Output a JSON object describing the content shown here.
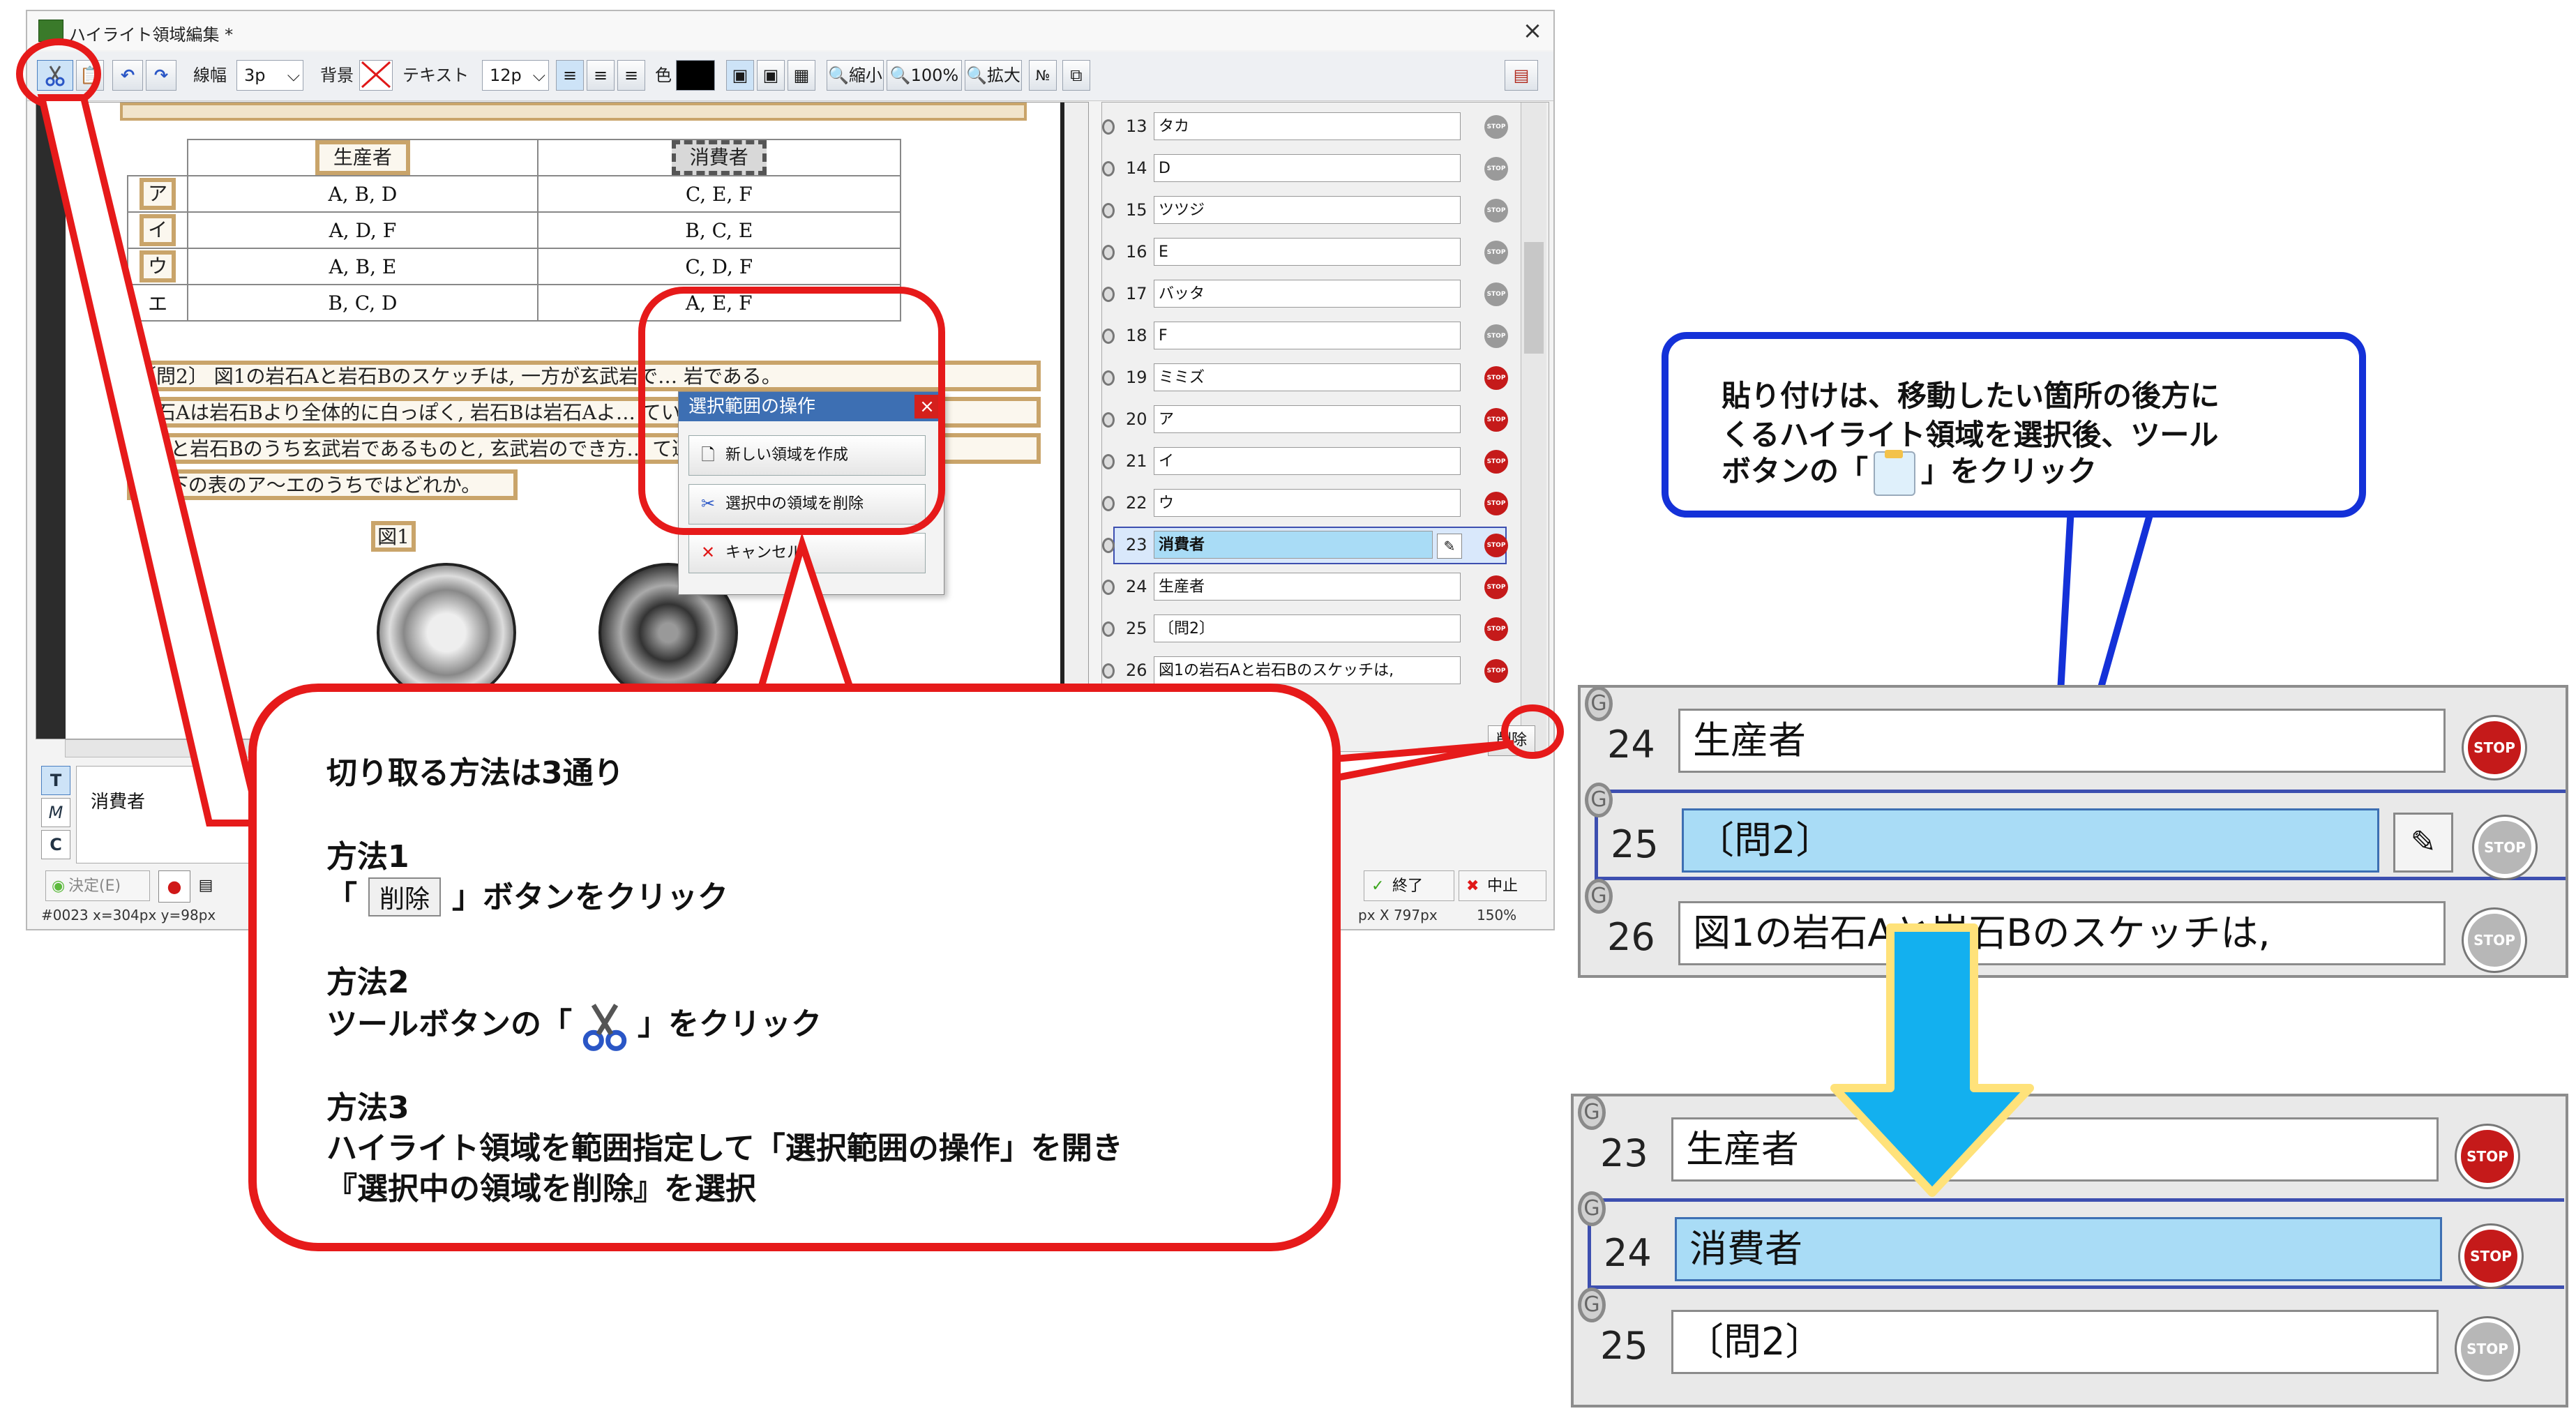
{
  "window": {
    "title": "ハイライト領域編集 *",
    "close_glyph": "×"
  },
  "toolbar": {
    "line_width_label": "線幅",
    "line_width_value": "3p",
    "background_label": "背景",
    "text_label": "テキスト",
    "font_size_value": "12p",
    "color_label": "色",
    "zoom_out_label": "縮小",
    "zoom_value": "100%",
    "zoom_in_label": "拡大",
    "number_label": "№"
  },
  "document": {
    "table_header": [
      "生産者",
      "消費者"
    ],
    "rows": [
      {
        "label": "ア",
        "a": "A, B, D",
        "b": "C, E, F"
      },
      {
        "label": "イ",
        "a": "A, D, F",
        "b": "B, C, E"
      },
      {
        "label": "ウ",
        "a": "A, B, E",
        "b": "C, D, F"
      },
      {
        "label": "エ",
        "a": "B, C, D",
        "b": "A, E, F"
      }
    ],
    "para_lines": [
      "〔問2〕 図1の岩石Aと岩石Bのスケッチは, 一方が玄武岩で… 岩である。",
      "岩石Aは岩石Bより全体的に白っぽく, 岩石Bは岩石Aよ… ていた。岩",
      "石Aと岩石Bのうち玄武岩であるものと, 玄武岩のでき方… て適切なの",
      "は, 下の表のア〜エのうちではどれか。"
    ],
    "figure_label": "図1"
  },
  "popup": {
    "title": "選択範囲の操作",
    "close_glyph": "×",
    "buttons": [
      "新しい領域を作成",
      "選択中の領域を削除",
      "キャンセル"
    ]
  },
  "list": {
    "items": [
      {
        "num": "13",
        "text": "タカ",
        "stop": "STOP"
      },
      {
        "num": "14",
        "text": "D",
        "stop": "STOP"
      },
      {
        "num": "15",
        "text": "ツツジ",
        "stop": "STOP"
      },
      {
        "num": "16",
        "text": "E",
        "stop": "STOP"
      },
      {
        "num": "17",
        "text": "バッタ",
        "stop": "STOP"
      },
      {
        "num": "18",
        "text": "F",
        "stop": "STOP"
      },
      {
        "num": "19",
        "text": "ミミズ",
        "stop": "STOP"
      },
      {
        "num": "20",
        "text": "ア",
        "stop": "STOP"
      },
      {
        "num": "21",
        "text": "イ",
        "stop": "STOP"
      },
      {
        "num": "22",
        "text": "ウ",
        "stop": "STOP"
      },
      {
        "num": "23",
        "text": "消費者",
        "stop": "STOP"
      },
      {
        "num": "24",
        "text": "生産者",
        "stop": "STOP"
      },
      {
        "num": "25",
        "text": "〔問2〕",
        "stop": "STOP"
      },
      {
        "num": "26",
        "text": "図1の岩石Aと岩石Bのスケッチは,",
        "stop": "STOP"
      }
    ],
    "delete_button": "削除"
  },
  "bottom": {
    "mode_buttons": [
      "T",
      "M",
      "C"
    ],
    "text_value": "消費者",
    "decide_button": "決定(E)",
    "finish_button": "終了",
    "cancel_button": "中止",
    "status_left": "#0023 x=304px y=98px",
    "status_size": "px X 797px",
    "status_zoom": "150%"
  },
  "callout_red": {
    "heading": "切り取る方法は3通り",
    "m1_title": "方法1",
    "m1_pre": "「",
    "m1_key": "削除",
    "m1_post": "」ボタンをクリック",
    "m2_title": "方法2",
    "m2_pre": "ツールボタンの「",
    "m2_post": "」をクリック",
    "m3_title": "方法3",
    "m3_line1": "ハイライト領域を範囲指定して「選択範囲の操作」を開き",
    "m3_line2": "『選択中の領域を削除』を選択"
  },
  "callout_blue": {
    "line1": "貼り付けは、移動したい箇所の後方に",
    "line2": "くるハイライト領域を選択後、ツール",
    "line3_pre": "ボタンの「",
    "line3_post": "」をクリック"
  },
  "zoom_before": [
    {
      "num": "24",
      "text": "生産者",
      "stop": "STOP"
    },
    {
      "num": "25",
      "text": "〔問2〕",
      "stop": "STOP"
    },
    {
      "num": "26",
      "text": "図1の岩石Aと岩石Bのスケッチは,",
      "stop": "STOP"
    }
  ],
  "zoom_after": [
    {
      "num": "23",
      "text": "生産者",
      "stop": "STOP"
    },
    {
      "num": "24",
      "text": "消費者",
      "stop": "STOP"
    },
    {
      "num": "25",
      "text": "〔問2〕",
      "stop": "STOP"
    }
  ],
  "ring_letter": "G",
  "colors": {
    "red": "#e61a1a",
    "blue": "#1431d8",
    "arrow": "#13b0ef",
    "arrow_outline": "#ffe27a",
    "selected_row": "#a9dcf6"
  }
}
